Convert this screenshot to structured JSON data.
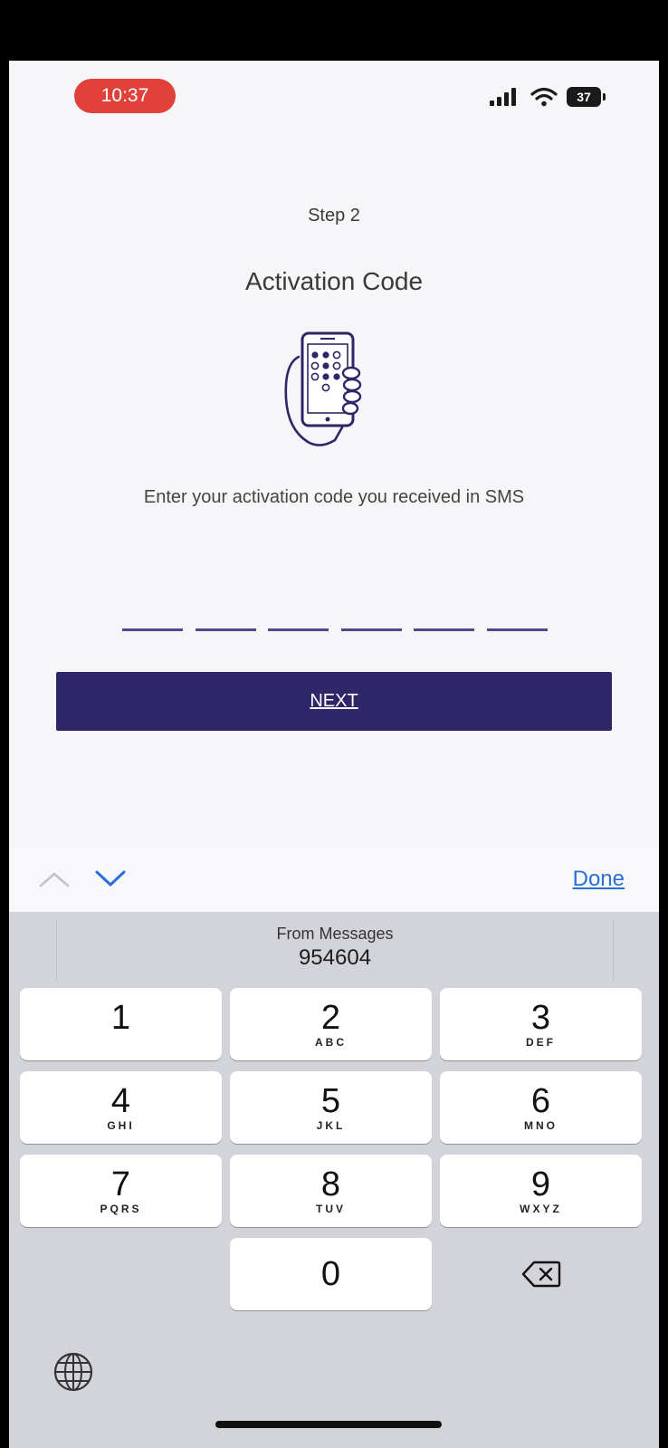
{
  "status_bar": {
    "time": "10:37",
    "battery_level": "37"
  },
  "main": {
    "step_label": "Step 2",
    "title": "Activation Code",
    "instruction": "Enter your activation code you received in SMS",
    "code_length": 6,
    "next_label": "NEXT"
  },
  "accessory_bar": {
    "done_label": "Done"
  },
  "keyboard": {
    "suggestion_source": "From Messages",
    "suggestion_code": "954604",
    "keys": [
      {
        "digit": "1",
        "letters": ""
      },
      {
        "digit": "2",
        "letters": "ABC"
      },
      {
        "digit": "3",
        "letters": "DEF"
      },
      {
        "digit": "4",
        "letters": "GHI"
      },
      {
        "digit": "5",
        "letters": "JKL"
      },
      {
        "digit": "6",
        "letters": "MNO"
      },
      {
        "digit": "7",
        "letters": "PQRS"
      },
      {
        "digit": "8",
        "letters": "TUV"
      },
      {
        "digit": "9",
        "letters": "WXYZ"
      },
      {
        "digit": "0",
        "letters": ""
      }
    ]
  },
  "colors": {
    "accent": "#2e2667",
    "time_pill": "#e0413a",
    "link": "#2a6fd6"
  },
  "icons": [
    "cellular-signal-icon",
    "wifi-icon",
    "battery-icon",
    "phone-hand-illustration",
    "chevron-up-icon",
    "chevron-down-icon",
    "delete-icon",
    "globe-icon"
  ]
}
